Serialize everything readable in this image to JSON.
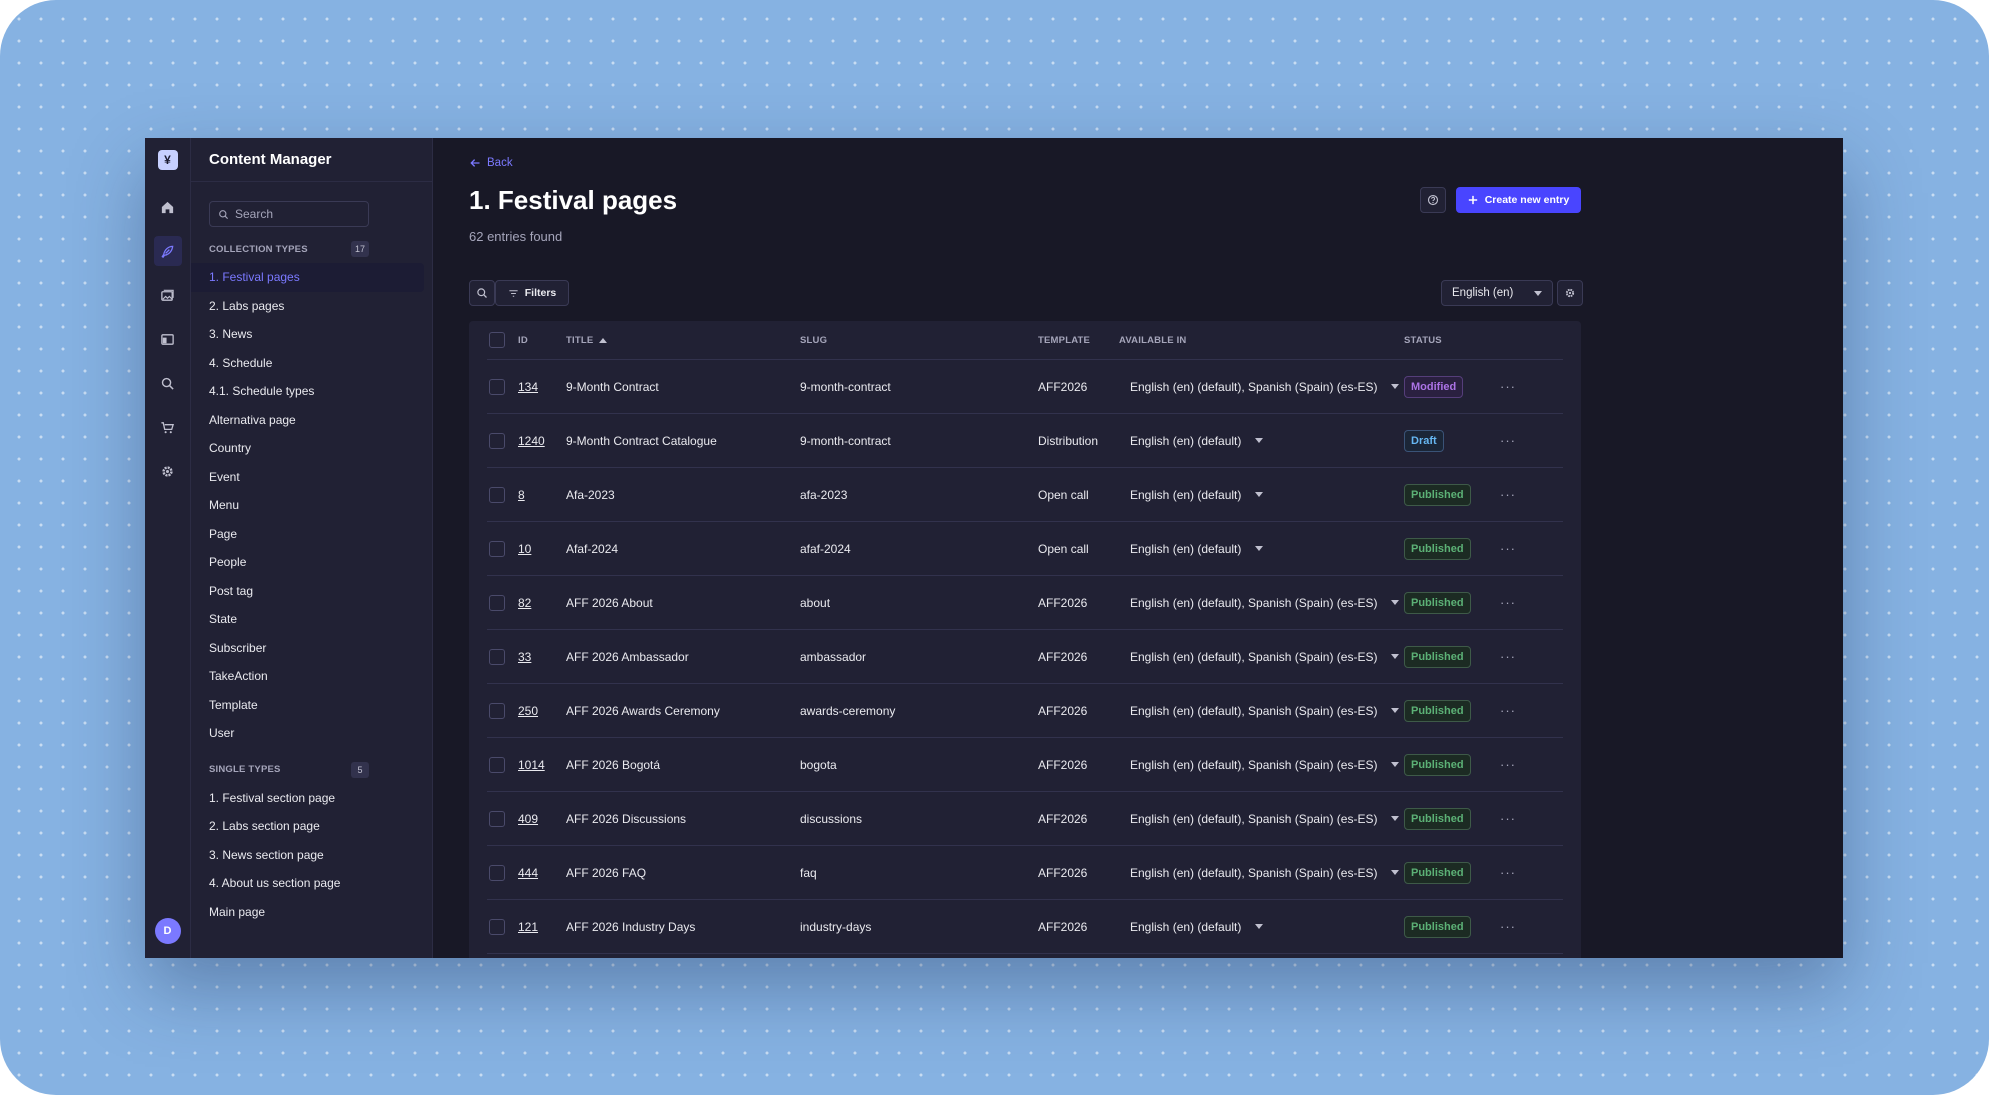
{
  "colors": {
    "accent": "#4945ff",
    "accent_text": "#7b79ff",
    "published": "#5cb176",
    "draft": "#66b7f1",
    "modified": "#ac73e6"
  },
  "rail": {
    "logo": "¥",
    "icons": [
      "home-icon",
      "feather-icon",
      "images-icon",
      "layout-icon",
      "search-icon",
      "cart-icon",
      "gear-icon"
    ],
    "avatar": "D"
  },
  "sidebar": {
    "title": "Content Manager",
    "search_placeholder": "Search",
    "collection_label": "COLLECTION TYPES",
    "collection_count": "17",
    "collection_items": [
      "1. Festival pages",
      "2. Labs pages",
      "3. News",
      "4. Schedule",
      "4.1. Schedule types",
      "Alternativa page",
      "Country",
      "Event",
      "Menu",
      "Page",
      "People",
      "Post tag",
      "State",
      "Subscriber",
      "TakeAction",
      "Template",
      "User"
    ],
    "single_label": "SINGLE TYPES",
    "single_count": "5",
    "single_items": [
      "1. Festival section page",
      "2. Labs section page",
      "3. News section page",
      "4. About us section page",
      "Main page"
    ]
  },
  "header": {
    "back_label": "Back",
    "title": "1. Festival pages",
    "subtitle": "62 entries found",
    "create_label": "Create new entry"
  },
  "toolbar": {
    "filters_label": "Filters",
    "locale": "English (en)"
  },
  "table": {
    "columns": {
      "id": "ID",
      "title": "TITLE",
      "slug": "SLUG",
      "template": "TEMPLATE",
      "available": "AVAILABLE IN",
      "status": "STATUS"
    },
    "rows": [
      {
        "id": "134",
        "title": "9-Month Contract",
        "slug": "9-month-contract",
        "template": "AFF2026",
        "available": "English (en) (default), Spanish (Spain) (es-ES)",
        "status": "Modified"
      },
      {
        "id": "1240",
        "title": "9-Month Contract Catalogue",
        "slug": "9-month-contract",
        "template": "Distribution",
        "available": "English (en) (default)",
        "status": "Draft"
      },
      {
        "id": "8",
        "title": "Afa-2023",
        "slug": "afa-2023",
        "template": "Open call",
        "available": "English (en) (default)",
        "status": "Published"
      },
      {
        "id": "10",
        "title": "Afaf-2024",
        "slug": "afaf-2024",
        "template": "Open call",
        "available": "English (en) (default)",
        "status": "Published"
      },
      {
        "id": "82",
        "title": "AFF 2026 About",
        "slug": "about",
        "template": "AFF2026",
        "available": "English (en) (default), Spanish (Spain) (es-ES)",
        "status": "Published"
      },
      {
        "id": "33",
        "title": "AFF 2026 Ambassador",
        "slug": "ambassador",
        "template": "AFF2026",
        "available": "English (en) (default), Spanish (Spain) (es-ES)",
        "status": "Published"
      },
      {
        "id": "250",
        "title": "AFF 2026 Awards Ceremony",
        "slug": "awards-ceremony",
        "template": "AFF2026",
        "available": "English (en) (default), Spanish (Spain) (es-ES)",
        "status": "Published"
      },
      {
        "id": "1014",
        "title": "AFF 2026 Bogotá",
        "slug": "bogota",
        "template": "AFF2026",
        "available": "English (en) (default), Spanish (Spain) (es-ES)",
        "status": "Published"
      },
      {
        "id": "409",
        "title": "AFF 2026 Discussions",
        "slug": "discussions",
        "template": "AFF2026",
        "available": "English (en) (default), Spanish (Spain) (es-ES)",
        "status": "Published"
      },
      {
        "id": "444",
        "title": "AFF 2026 FAQ",
        "slug": "faq",
        "template": "AFF2026",
        "available": "English (en) (default), Spanish (Spain) (es-ES)",
        "status": "Published"
      },
      {
        "id": "121",
        "title": "AFF 2026 Industry Days",
        "slug": "industry-days",
        "template": "AFF2026",
        "available": "English (en) (default)",
        "status": "Published"
      }
    ]
  }
}
